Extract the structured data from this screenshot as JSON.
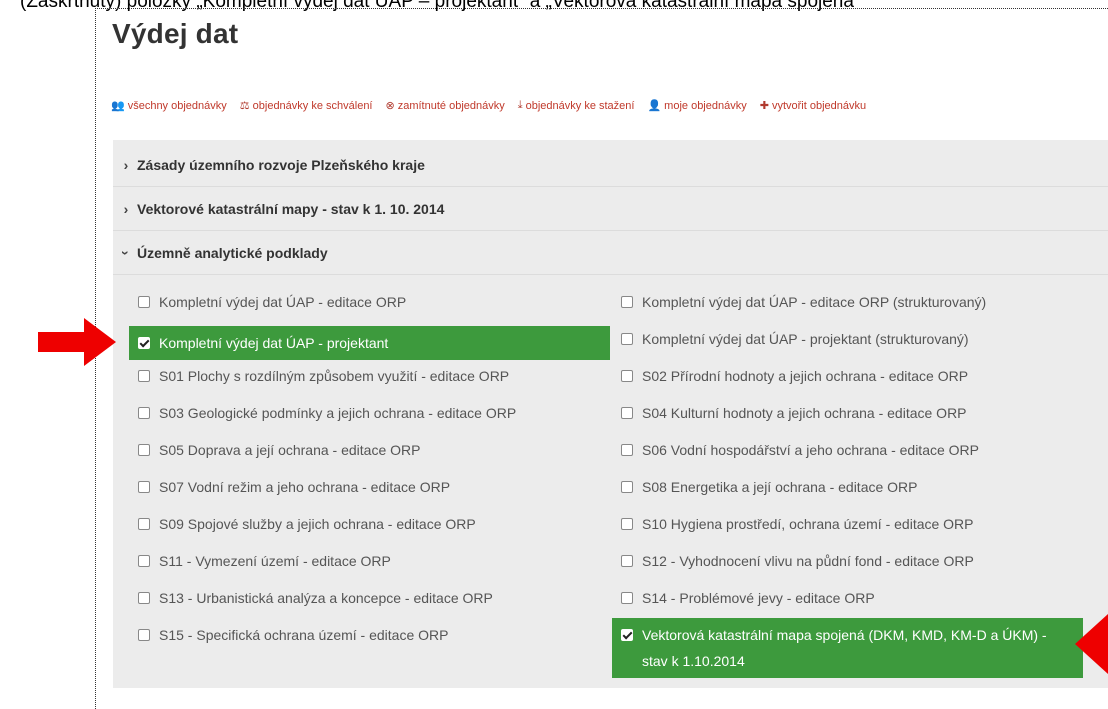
{
  "caption": "(Zaškrtnuty) položky „Kompletní výdej dat ÚAP – projektant“ a „Vektorová katastrální mapa spojená“",
  "page_title": "Výdej dat",
  "toolbar": [
    {
      "icon": "users-icon",
      "glyph": "👥",
      "label": "všechny objednávky"
    },
    {
      "icon": "gavel-icon",
      "glyph": "⚖",
      "label": "objednávky ke schválení"
    },
    {
      "icon": "cancel-circle-icon",
      "glyph": "⊗",
      "label": "zamítnuté objednávky"
    },
    {
      "icon": "download-icon",
      "glyph": "⤓",
      "label": "objednávky ke stažení"
    },
    {
      "icon": "user-icon",
      "glyph": "👤",
      "label": "moje objednávky"
    },
    {
      "icon": "plus-icon",
      "glyph": "✚",
      "label": "vytvořit objednávku"
    }
  ],
  "sections": [
    {
      "label": "Zásady územního rozvoje Plzeňského kraje",
      "expanded": false
    },
    {
      "label": "Vektorové katastrální mapy - stav k 1. 10. 2014",
      "expanded": false
    },
    {
      "label": "Územně analytické podklady",
      "expanded": true
    }
  ],
  "items_left": [
    {
      "label": "Kompletní výdej dat ÚAP - editace ORP",
      "checked": false
    },
    {
      "label": "Kompletní výdej dat ÚAP - projektant",
      "checked": true
    },
    {
      "label": "S01 Plochy s rozdílným způsobem využití - editace ORP",
      "checked": false
    },
    {
      "label": "S03 Geologické podmínky a jejich ochrana - editace ORP",
      "checked": false
    },
    {
      "label": "S05 Doprava a její ochrana - editace ORP",
      "checked": false
    },
    {
      "label": "S07 Vodní režim a jeho ochrana - editace ORP",
      "checked": false
    },
    {
      "label": "S09 Spojové služby a jejich ochrana - editace ORP",
      "checked": false
    },
    {
      "label": "S11 - Vymezení území - editace ORP",
      "checked": false
    },
    {
      "label": "S13 - Urbanistická analýza a koncepce - editace ORP",
      "checked": false
    },
    {
      "label": "S15 - Specifická ochrana území - editace ORP",
      "checked": false
    }
  ],
  "items_right": [
    {
      "label": "Kompletní výdej dat ÚAP - editace ORP (strukturovaný)",
      "checked": false
    },
    {
      "label": "Kompletní výdej dat ÚAP - projektant (strukturovaný)",
      "checked": false
    },
    {
      "label": "S02 Přírodní hodnoty a jejich ochrana - editace ORP",
      "checked": false
    },
    {
      "label": "S04 Kulturní hodnoty a jejich ochrana - editace ORP",
      "checked": false
    },
    {
      "label": "S06 Vodní hospodářství a jeho ochrana - editace ORP",
      "checked": false
    },
    {
      "label": "S08 Energetika a její ochrana - editace ORP",
      "checked": false
    },
    {
      "label": "S10 Hygiena prostředí, ochrana území - editace ORP",
      "checked": false
    },
    {
      "label": "S12 - Vyhodnocení vlivu na půdní fond - editace ORP",
      "checked": false
    },
    {
      "label": "S14 - Problémové jevy - editace ORP",
      "checked": false
    },
    {
      "label": "Vektorová katastrální mapa spojená (DKM, KMD, KM-D a ÚKM) - stav k 1.10.2014",
      "checked": true
    }
  ],
  "colors": {
    "accent_link": "#c0392b",
    "checked_bg": "#3d9a3d",
    "panel_bg": "#ececec",
    "arrow": "#ee0000"
  }
}
